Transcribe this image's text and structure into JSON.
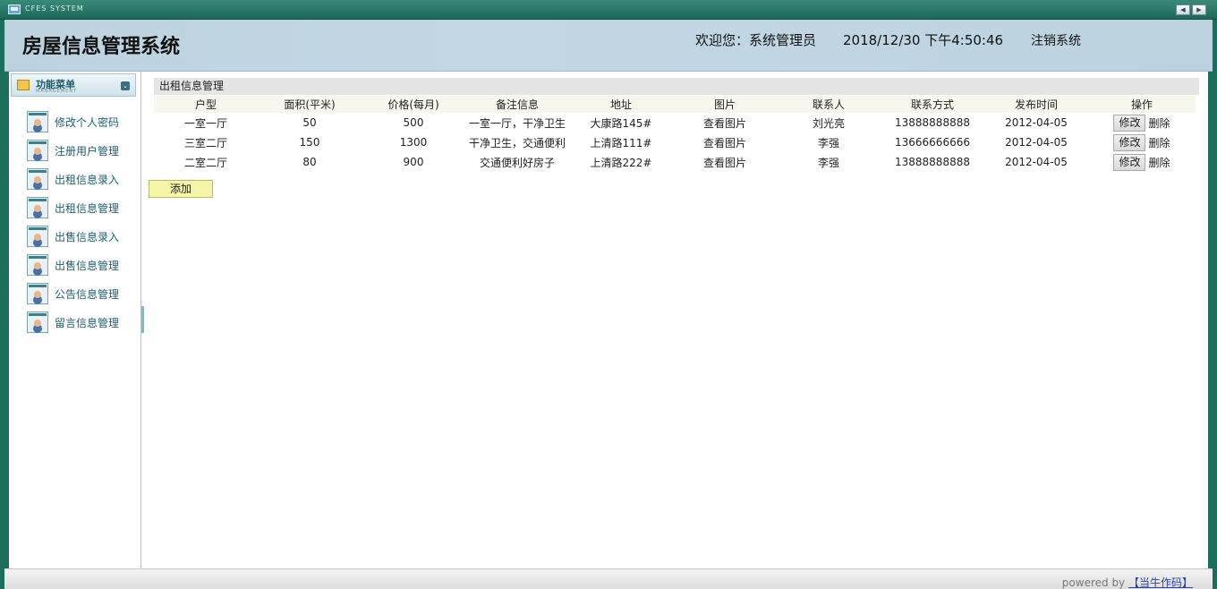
{
  "window": {
    "system_label": "CFES SYSTEM",
    "nav_prev": "◀",
    "nav_next": "▶"
  },
  "header": {
    "title": "房屋信息管理系统",
    "welcome": "欢迎您：系统管理员",
    "datetime": "2018/12/30 下午4:50:46",
    "logout": "注销系统"
  },
  "sidebar": {
    "menu_title": "功能菜单",
    "menu_subtitle": "MANAGEMENT",
    "items": [
      {
        "label": "修改个人密码"
      },
      {
        "label": "注册用户管理"
      },
      {
        "label": "出租信息录入"
      },
      {
        "label": "出租信息管理"
      },
      {
        "label": "出售信息录入"
      },
      {
        "label": "出售信息管理"
      },
      {
        "label": "公告信息管理"
      },
      {
        "label": "留言信息管理"
      }
    ]
  },
  "main": {
    "panel_title": "出租信息管理",
    "columns": [
      "户型",
      "面积(平米)",
      "价格(每月)",
      "备注信息",
      "地址",
      "图片",
      "联系人",
      "联系方式",
      "发布时间",
      "操作"
    ],
    "rows": [
      {
        "type": "一室一厅",
        "area": "50",
        "price": "500",
        "note": "一室一厅，干净卫生",
        "address": "大康路145#",
        "image": "查看图片",
        "contact": "刘光亮",
        "phone": "13888888888",
        "date": "2012-04-05"
      },
      {
        "type": "三室二厅",
        "area": "150",
        "price": "1300",
        "note": "干净卫生，交通便利",
        "address": "上清路111#",
        "image": "查看图片",
        "contact": "李强",
        "phone": "13666666666",
        "date": "2012-04-05"
      },
      {
        "type": "二室二厅",
        "area": "80",
        "price": "900",
        "note": "交通便利好房子",
        "address": "上清路222#",
        "image": "查看图片",
        "contact": "李强",
        "phone": "13888888888",
        "date": "2012-04-05"
      }
    ],
    "edit_label": "修改",
    "delete_label": "删除",
    "add_label": "添加"
  },
  "footer": {
    "powered": "powered by",
    "brand": "【当牛作码】"
  }
}
